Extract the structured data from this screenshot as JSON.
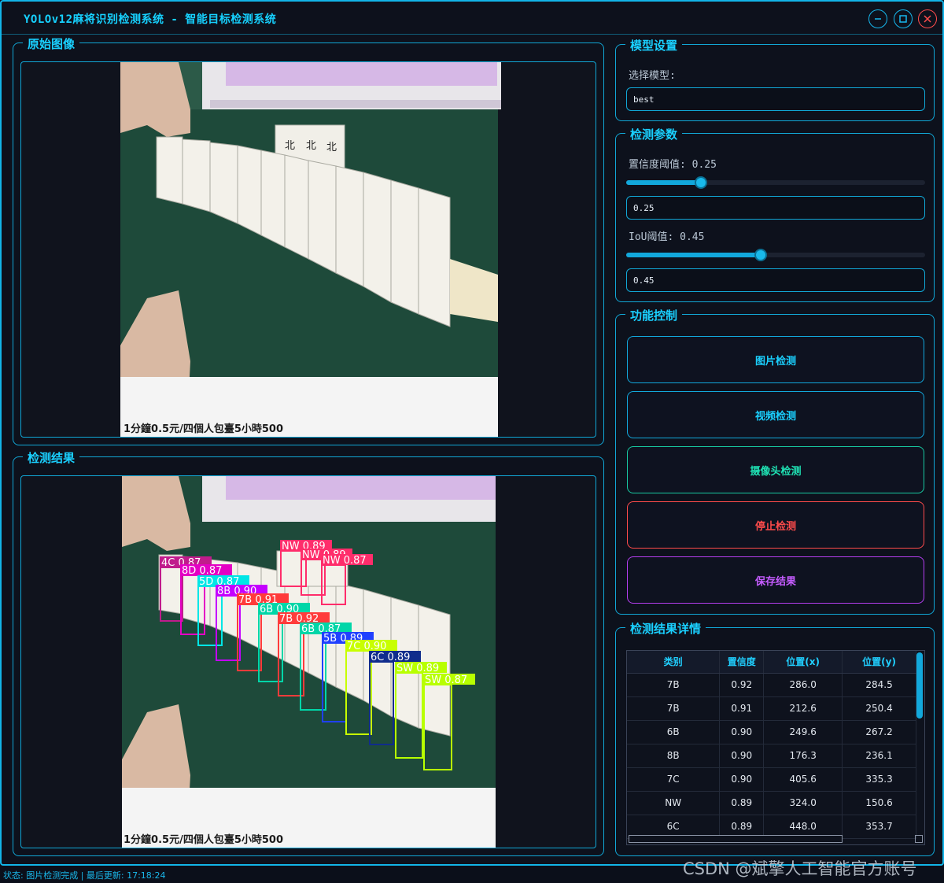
{
  "window": {
    "title": "YOLOv12麻将识别检测系统 - 智能目标检测系统",
    "minimize_icon": "minimize-icon",
    "maximize_icon": "maximize-icon",
    "close_icon": "close-icon"
  },
  "original_panel": {
    "title": "原始图像",
    "banner_text": "1分鐘0.5元/四個人包臺5小時500"
  },
  "result_panel": {
    "title": "检测结果",
    "banner_text": "1分鐘0.5元/四個人包臺5小時500"
  },
  "model_settings": {
    "title": "模型设置",
    "select_label": "选择模型:",
    "model_value": "best"
  },
  "detect_params": {
    "title": "检测参数",
    "conf_label": "置信度阈值: 0.25",
    "conf_slider_value": 0.25,
    "conf_value": "0.25",
    "iou_label": "IoU阈值: 0.45",
    "iou_slider_value": 0.45,
    "iou_value": "0.45"
  },
  "controls": {
    "title": "功能控制",
    "image_detect": "图片检测",
    "video_detect": "视频检测",
    "camera_detect": "摄像头检测",
    "stop_detect": "停止检测",
    "save_result": "保存结果"
  },
  "results_table": {
    "title": "检测结果详情",
    "columns": [
      "类别",
      "置信度",
      "位置(x)",
      "位置(y)"
    ],
    "rows": [
      [
        "7B",
        "0.92",
        "286.0",
        "284.5"
      ],
      [
        "7B",
        "0.91",
        "212.6",
        "250.4"
      ],
      [
        "6B",
        "0.90",
        "249.6",
        "267.2"
      ],
      [
        "8B",
        "0.90",
        "176.3",
        "236.1"
      ],
      [
        "7C",
        "0.90",
        "405.6",
        "335.3"
      ],
      [
        "NW",
        "0.89",
        "324.0",
        "150.6"
      ],
      [
        "6C",
        "0.89",
        "448.0",
        "353.7"
      ]
    ]
  },
  "detections": [
    {
      "label": "NW 0.89",
      "color": "#ff2d6b"
    },
    {
      "label": "NW 0.89",
      "color": "#ff2d6b"
    },
    {
      "label": "NW 0.87",
      "color": "#ff2d6b"
    },
    {
      "label": "4C 0.87",
      "color": "#c01c8c"
    },
    {
      "label": "8D 0.87",
      "color": "#e400c4"
    },
    {
      "label": "5D 0.87",
      "color": "#00e6e6"
    },
    {
      "label": "8B 0.90",
      "color": "#c400ff"
    },
    {
      "label": "7B 0.91",
      "color": "#ff3b3b"
    },
    {
      "label": "6B 0.90",
      "color": "#00d6a8"
    },
    {
      "label": "7B 0.92",
      "color": "#ff3b3b"
    },
    {
      "label": "6B 0.87",
      "color": "#00d6a8"
    },
    {
      "label": "5B 0.89",
      "color": "#2040ff"
    },
    {
      "label": "7C 0.90",
      "color": "#c8ff00"
    },
    {
      "label": "6C 0.89",
      "color": "#102c8c"
    },
    {
      "label": "SW 0.89",
      "color": "#b8ff00"
    },
    {
      "label": "SW 0.87",
      "color": "#b8ff00"
    }
  ],
  "status": {
    "text": "状态: 图片检测完成 | 最后更新: 17:18:24"
  },
  "watermark": "CSDN @斌擎人工智能官方账号"
}
